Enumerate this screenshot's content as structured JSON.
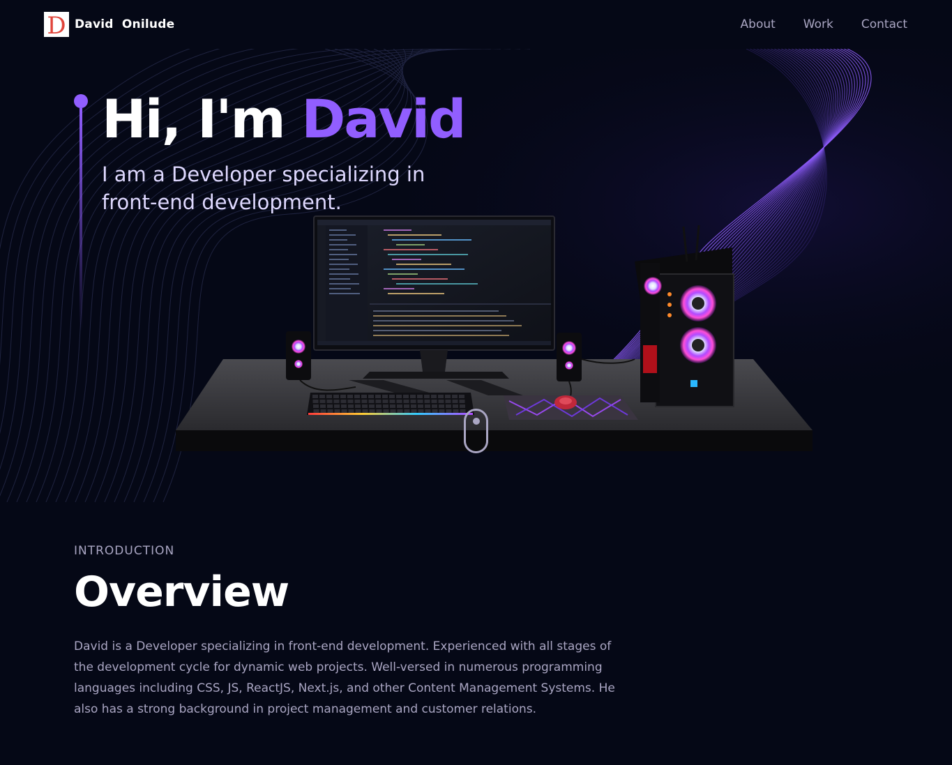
{
  "navbar": {
    "logo_letter": "D",
    "brand_name": "David  Onilude",
    "links": [
      "About",
      "Work",
      "Contact"
    ]
  },
  "hero": {
    "greeting": "Hi, I'm ",
    "name": "David",
    "subtitle": "I am a Developer specializing in front-end development."
  },
  "overview": {
    "label": "INTRODUCTION",
    "title": "Overview",
    "text": "David is a Developer specializing in front-end development. Experienced with all stages of the development cycle for dynamic web projects. Well-versed in numerous programming languages including CSS, JS, ReactJS, Next.js, and other Content Management Systems. He also has a strong background in project management and customer relations."
  },
  "colors": {
    "background": "#050816",
    "accent": "#915eff",
    "secondary_text": "#aaa6c3",
    "logo_red": "#e0443a"
  }
}
